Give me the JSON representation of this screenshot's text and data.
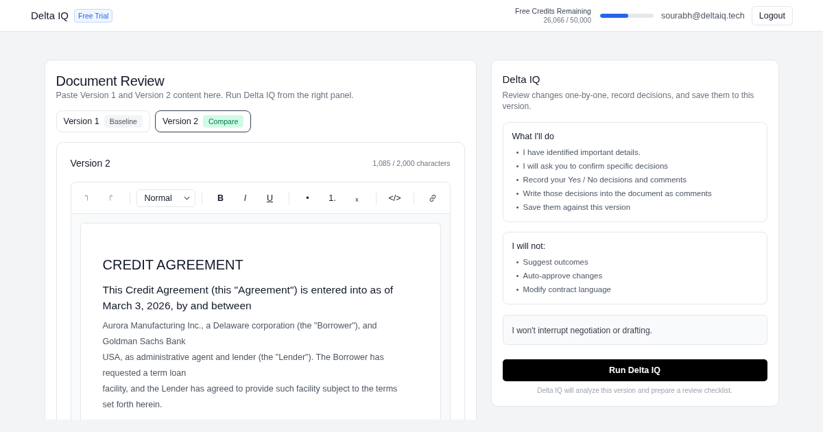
{
  "header": {
    "brand": "Delta IQ",
    "plan_badge": "Free Trial",
    "credits": {
      "label": "Free Credits Remaining",
      "reading": "26,066 / 50,000",
      "level": 0.52
    },
    "user_email": "sourabh@deltaiq.tech",
    "logout_button": "Logout"
  },
  "document_review": {
    "title": "Document Review",
    "subtitle": "Paste Version 1 and Version 2 content here. Run Delta IQ from the right panel.",
    "tabs": [
      {
        "label": "Version 1",
        "badge": "Baseline",
        "kind": "baseline",
        "selected": false
      },
      {
        "label": "Version 2",
        "badge": "Compare",
        "kind": "compare",
        "selected": true
      }
    ],
    "editor": {
      "title": "Version 2",
      "char_count": "1,085 / 2,000 characters",
      "toolbar": [
        [
          {
            "kind": "undo"
          },
          {
            "kind": "redo"
          }
        ],
        [
          {
            "kind": "select",
            "value": "Normal"
          }
        ],
        [
          {
            "kind": "bold",
            "label": "B"
          },
          {
            "kind": "italic",
            "label": "I"
          },
          {
            "kind": "underline",
            "label": "U"
          }
        ],
        [
          {
            "kind": "bullet_list",
            "label": "•"
          },
          {
            "kind": "numbered_list",
            "label": "1."
          },
          {
            "kind": "subscript",
            "label": "ₓ"
          }
        ],
        [
          {
            "kind": "code",
            "label": "</>"
          }
        ],
        [
          {
            "kind": "link"
          }
        ]
      ],
      "document": {
        "title": "CREDIT AGREEMENT",
        "heading": "This Credit Agreement (this \"Agreement\") is entered into as of March 3, 2026, by and between",
        "lines": [
          "Aurora Manufacturing Inc., a Delaware corporation (the \"Borrower\"), and Goldman Sachs Bank",
          "USA, as administrative agent and lender (the \"Lender\"). The Borrower has requested a term loan",
          "facility, and the Lender has agreed to provide such facility subject to the terms set forth herein."
        ]
      }
    }
  },
  "assistant_panel": {
    "title": "Delta IQ",
    "description": "Review changes one-by-one, record decisions, and save them to this version.",
    "sections": [
      {
        "heading": "What I'll do",
        "items": [
          "I have identified important details.",
          "I will ask you to confirm specific decisions",
          "Record your Yes / No decisions and comments",
          "Write those decisions into the document as comments",
          "Save them against this version"
        ]
      },
      {
        "heading": "I will not:",
        "items": [
          "Suggest outcomes",
          "Auto-approve changes",
          "Modify contract language"
        ]
      }
    ],
    "note": "I won't interrupt negotiation or drafting.",
    "run_button": "Run Delta IQ",
    "caption": "Delta IQ will analyze this version and prepare a review checklist."
  }
}
